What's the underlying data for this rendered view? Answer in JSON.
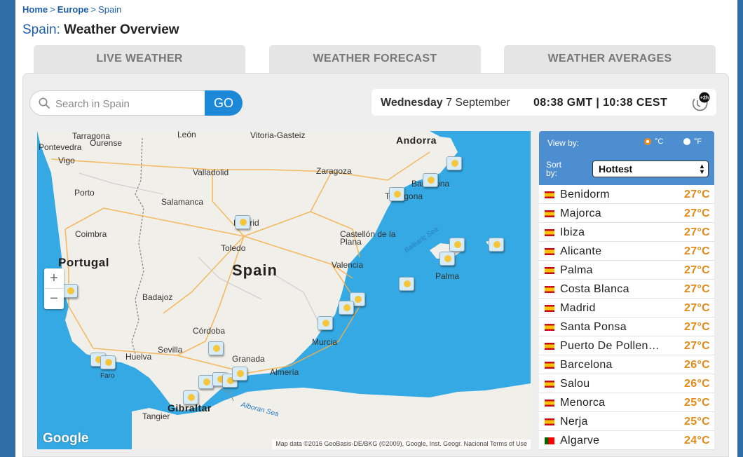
{
  "breadcrumb": [
    {
      "label": "Home",
      "bold": true
    },
    {
      "label": "Europe",
      "bold": true
    },
    {
      "label": "Spain",
      "bold": false
    }
  ],
  "title": {
    "country": "Spain:",
    "text": "Weather Overview"
  },
  "tabs": [
    "LIVE WEATHER",
    "WEATHER FORECAST",
    "WEATHER AVERAGES"
  ],
  "search": {
    "placeholder": "Search in Spain",
    "button": "GO"
  },
  "time": {
    "weekday": "Wednesday",
    "date": "7 September",
    "clock": "08:38 GMT | 10:38 CEST",
    "clock_badge": "+2h"
  },
  "map": {
    "labels": [
      "Pontevedra",
      "Ourense",
      "Vigo",
      "Valladolid",
      "Zaragoza",
      "Andorra",
      "Porto",
      "Salamanca",
      "Madrid",
      "Coimbra",
      "Toledo",
      "Castellón de la Plana",
      "Portugal",
      "Spain",
      "Valencia",
      "Badajoz",
      "Palma",
      "Córdoba",
      "Murcia",
      "Sevilla",
      "Huelva",
      "Granada",
      "Almería",
      "Faro",
      "Gibraltar",
      "Tangier",
      "Balearic Sea",
      "Alboran Sea",
      "Vitoria-Gasteiz",
      "León",
      "Compostela",
      "Barcelona",
      "Tarragona"
    ],
    "zoom_in": "+",
    "zoom_out": "−",
    "google": "Google",
    "attribution": "Map data ©2016 GeoBasis-DE/BKG (©2009), Google, Inst. Geogr. Nacional   Terms of Use",
    "weather_icon": "sun-cloud-icon"
  },
  "sidebar": {
    "view_by": "View by:",
    "unit_c": "°C",
    "unit_f": "°F",
    "sort_by": "Sort by:",
    "sort_value": "Hottest",
    "rows": [
      {
        "flag": "es",
        "city": "Benidorm",
        "temp": "27°C"
      },
      {
        "flag": "es",
        "city": "Majorca",
        "temp": "27°C"
      },
      {
        "flag": "es",
        "city": "Ibiza",
        "temp": "27°C"
      },
      {
        "flag": "es",
        "city": "Alicante",
        "temp": "27°C"
      },
      {
        "flag": "es",
        "city": "Palma",
        "temp": "27°C"
      },
      {
        "flag": "es",
        "city": "Costa Blanca",
        "temp": "27°C"
      },
      {
        "flag": "es",
        "city": "Madrid",
        "temp": "27°C"
      },
      {
        "flag": "es",
        "city": "Santa Ponsa",
        "temp": "27°C"
      },
      {
        "flag": "es",
        "city": "Puerto De Pollen…",
        "temp": "27°C"
      },
      {
        "flag": "es",
        "city": "Barcelona",
        "temp": "26°C"
      },
      {
        "flag": "es",
        "city": "Salou",
        "temp": "26°C"
      },
      {
        "flag": "es",
        "city": "Menorca",
        "temp": "25°C"
      },
      {
        "flag": "es",
        "city": "Nerja",
        "temp": "25°C"
      },
      {
        "flag": "pt",
        "city": "Algarve",
        "temp": "24°C"
      }
    ]
  },
  "colors": {
    "accent": "#1e88d8",
    "temp": "#e28a17",
    "sidebar_head": "#4d8ed0",
    "sea": "#34a9e3",
    "land": "#f1efe9"
  }
}
